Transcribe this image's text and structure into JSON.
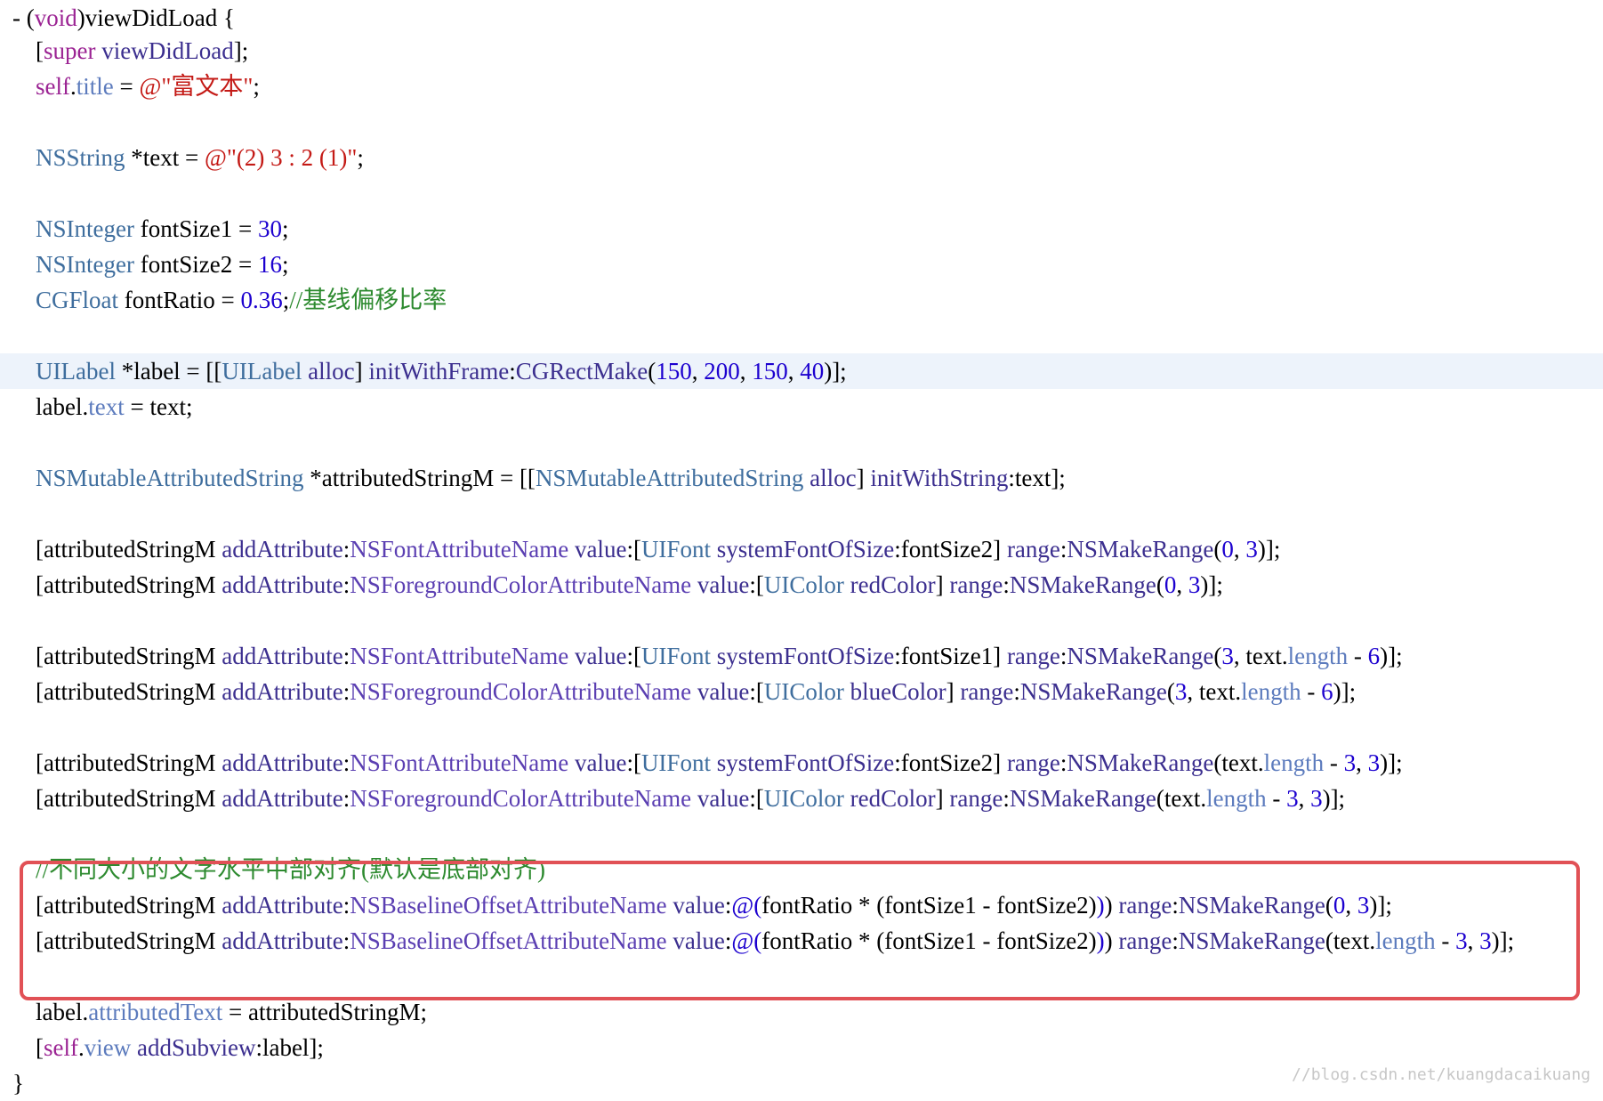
{
  "code": {
    "lines": [
      {
        "tokens": [
          [
            "plain",
            "- ("
          ],
          [
            "keyword",
            "void"
          ],
          [
            "plain",
            ")viewDidLoad {"
          ]
        ]
      },
      {
        "tokens": [
          [
            "plain",
            "["
          ],
          [
            "keyword",
            "super"
          ],
          [
            "plain",
            " "
          ],
          [
            "method",
            "viewDidLoad"
          ],
          [
            "plain",
            "];"
          ]
        ]
      },
      {
        "tokens": [
          [
            "keyword",
            "self"
          ],
          [
            "plain",
            "."
          ],
          [
            "prop",
            "title"
          ],
          [
            "plain",
            " = "
          ],
          [
            "string",
            "@\"富文本\""
          ],
          [
            "plain",
            ";"
          ]
        ]
      },
      {
        "tokens": []
      },
      {
        "tokens": [
          [
            "type",
            "NSString"
          ],
          [
            "plain",
            " *text = "
          ],
          [
            "string",
            "@\"(2) 3 : 2 (1)\""
          ],
          [
            "plain",
            ";"
          ]
        ]
      },
      {
        "tokens": []
      },
      {
        "tokens": [
          [
            "type",
            "NSInteger"
          ],
          [
            "plain",
            " fontSize1 = "
          ],
          [
            "number",
            "30"
          ],
          [
            "plain",
            ";"
          ]
        ]
      },
      {
        "tokens": [
          [
            "type",
            "NSInteger"
          ],
          [
            "plain",
            " fontSize2 = "
          ],
          [
            "number",
            "16"
          ],
          [
            "plain",
            ";"
          ]
        ]
      },
      {
        "tokens": [
          [
            "type",
            "CGFloat"
          ],
          [
            "plain",
            " fontRatio = "
          ],
          [
            "number",
            "0.36"
          ],
          [
            "plain",
            ";"
          ],
          [
            "comment",
            "//基线偏移比率"
          ]
        ]
      },
      {
        "tokens": []
      },
      {
        "tokens": [
          [
            "type",
            "UILabel"
          ],
          [
            "plain",
            " *label = [["
          ],
          [
            "type",
            "UILabel"
          ],
          [
            "plain",
            " "
          ],
          [
            "method",
            "alloc"
          ],
          [
            "plain",
            "] "
          ],
          [
            "method",
            "initWithFrame"
          ],
          [
            "plain",
            ":"
          ],
          [
            "method",
            "CGRectMake"
          ],
          [
            "plain",
            "("
          ],
          [
            "number",
            "150"
          ],
          [
            "plain",
            ", "
          ],
          [
            "number",
            "200"
          ],
          [
            "plain",
            ", "
          ],
          [
            "number",
            "150"
          ],
          [
            "plain",
            ", "
          ],
          [
            "number",
            "40"
          ],
          [
            "plain",
            ")];"
          ]
        ]
      },
      {
        "tokens": [
          [
            "plain",
            "label."
          ],
          [
            "prop",
            "text"
          ],
          [
            "plain",
            " = text;"
          ]
        ]
      },
      {
        "tokens": []
      },
      {
        "tokens": [
          [
            "type",
            "NSMutableAttributedString"
          ],
          [
            "plain",
            " *attributedStringM = [["
          ],
          [
            "type",
            "NSMutableAttributedString"
          ],
          [
            "plain",
            " "
          ],
          [
            "method",
            "alloc"
          ],
          [
            "plain",
            "] "
          ],
          [
            "method",
            "initWithString"
          ],
          [
            "plain",
            ":text];"
          ]
        ]
      },
      {
        "tokens": []
      },
      {
        "tokens": [
          [
            "plain",
            "[attributedStringM "
          ],
          [
            "method",
            "addAttribute"
          ],
          [
            "plain",
            ":"
          ],
          [
            "const",
            "NSFontAttributeName"
          ],
          [
            "plain",
            " "
          ],
          [
            "method",
            "value"
          ],
          [
            "plain",
            ":["
          ],
          [
            "type",
            "UIFont"
          ],
          [
            "plain",
            " "
          ],
          [
            "method",
            "systemFontOfSize"
          ],
          [
            "plain",
            ":fontSize2] "
          ],
          [
            "method",
            "range"
          ],
          [
            "plain",
            ":"
          ],
          [
            "method",
            "NSMakeRange"
          ],
          [
            "plain",
            "("
          ],
          [
            "number",
            "0"
          ],
          [
            "plain",
            ", "
          ],
          [
            "number",
            "3"
          ],
          [
            "plain",
            ")];"
          ]
        ]
      },
      {
        "tokens": [
          [
            "plain",
            "[attributedStringM "
          ],
          [
            "method",
            "addAttribute"
          ],
          [
            "plain",
            ":"
          ],
          [
            "const",
            "NSForegroundColorAttributeName"
          ],
          [
            "plain",
            " "
          ],
          [
            "method",
            "value"
          ],
          [
            "plain",
            ":["
          ],
          [
            "type",
            "UIColor"
          ],
          [
            "plain",
            " "
          ],
          [
            "method",
            "redColor"
          ],
          [
            "plain",
            "] "
          ],
          [
            "method",
            "range"
          ],
          [
            "plain",
            ":"
          ],
          [
            "method",
            "NSMakeRange"
          ],
          [
            "plain",
            "("
          ],
          [
            "number",
            "0"
          ],
          [
            "plain",
            ", "
          ],
          [
            "number",
            "3"
          ],
          [
            "plain",
            ")];"
          ]
        ]
      },
      {
        "tokens": []
      },
      {
        "tokens": [
          [
            "plain",
            "[attributedStringM "
          ],
          [
            "method",
            "addAttribute"
          ],
          [
            "plain",
            ":"
          ],
          [
            "const",
            "NSFontAttributeName"
          ],
          [
            "plain",
            " "
          ],
          [
            "method",
            "value"
          ],
          [
            "plain",
            ":["
          ],
          [
            "type",
            "UIFont"
          ],
          [
            "plain",
            " "
          ],
          [
            "method",
            "systemFontOfSize"
          ],
          [
            "plain",
            ":fontSize1] "
          ],
          [
            "method",
            "range"
          ],
          [
            "plain",
            ":"
          ],
          [
            "method",
            "NSMakeRange"
          ],
          [
            "plain",
            "("
          ],
          [
            "number",
            "3"
          ],
          [
            "plain",
            ", text."
          ],
          [
            "prop",
            "length"
          ],
          [
            "plain",
            " - "
          ],
          [
            "number",
            "6"
          ],
          [
            "plain",
            ")];"
          ]
        ]
      },
      {
        "tokens": [
          [
            "plain",
            "[attributedStringM "
          ],
          [
            "method",
            "addAttribute"
          ],
          [
            "plain",
            ":"
          ],
          [
            "const",
            "NSForegroundColorAttributeName"
          ],
          [
            "plain",
            " "
          ],
          [
            "method",
            "value"
          ],
          [
            "plain",
            ":["
          ],
          [
            "type",
            "UIColor"
          ],
          [
            "plain",
            " "
          ],
          [
            "method",
            "blueColor"
          ],
          [
            "plain",
            "] "
          ],
          [
            "method",
            "range"
          ],
          [
            "plain",
            ":"
          ],
          [
            "method",
            "NSMakeRange"
          ],
          [
            "plain",
            "("
          ],
          [
            "number",
            "3"
          ],
          [
            "plain",
            ", text."
          ],
          [
            "prop",
            "length"
          ],
          [
            "plain",
            " - "
          ],
          [
            "number",
            "6"
          ],
          [
            "plain",
            ")];"
          ]
        ]
      },
      {
        "tokens": []
      },
      {
        "tokens": [
          [
            "plain",
            "[attributedStringM "
          ],
          [
            "method",
            "addAttribute"
          ],
          [
            "plain",
            ":"
          ],
          [
            "const",
            "NSFontAttributeName"
          ],
          [
            "plain",
            " "
          ],
          [
            "method",
            "value"
          ],
          [
            "plain",
            ":["
          ],
          [
            "type",
            "UIFont"
          ],
          [
            "plain",
            " "
          ],
          [
            "method",
            "systemFontOfSize"
          ],
          [
            "plain",
            ":fontSize2] "
          ],
          [
            "method",
            "range"
          ],
          [
            "plain",
            ":"
          ],
          [
            "method",
            "NSMakeRange"
          ],
          [
            "plain",
            "(text."
          ],
          [
            "prop",
            "length"
          ],
          [
            "plain",
            " - "
          ],
          [
            "number",
            "3"
          ],
          [
            "plain",
            ", "
          ],
          [
            "number",
            "3"
          ],
          [
            "plain",
            ")];"
          ]
        ]
      },
      {
        "tokens": [
          [
            "plain",
            "[attributedStringM "
          ],
          [
            "method",
            "addAttribute"
          ],
          [
            "plain",
            ":"
          ],
          [
            "const",
            "NSForegroundColorAttributeName"
          ],
          [
            "plain",
            " "
          ],
          [
            "method",
            "value"
          ],
          [
            "plain",
            ":["
          ],
          [
            "type",
            "UIColor"
          ],
          [
            "plain",
            " "
          ],
          [
            "method",
            "redColor"
          ],
          [
            "plain",
            "] "
          ],
          [
            "method",
            "range"
          ],
          [
            "plain",
            ":"
          ],
          [
            "method",
            "NSMakeRange"
          ],
          [
            "plain",
            "(text."
          ],
          [
            "prop",
            "length"
          ],
          [
            "plain",
            " - "
          ],
          [
            "number",
            "3"
          ],
          [
            "plain",
            ", "
          ],
          [
            "number",
            "3"
          ],
          [
            "plain",
            ")];"
          ]
        ]
      },
      {
        "tokens": []
      },
      {
        "tokens": [
          [
            "comment",
            "//不同大小的文字水平中部对齐(默认是底部对齐)"
          ]
        ]
      },
      {
        "tokens": [
          [
            "plain",
            "[attributedStringM "
          ],
          [
            "method",
            "addAttribute"
          ],
          [
            "plain",
            ":"
          ],
          [
            "const",
            "NSBaselineOffsetAttributeName"
          ],
          [
            "plain",
            " "
          ],
          [
            "method",
            "value"
          ],
          [
            "plain",
            ":"
          ],
          [
            "number",
            "@("
          ],
          [
            "plain",
            "fontRatio * (fontSize1 - fontSize2)"
          ],
          [
            "number",
            ")"
          ],
          [
            "plain",
            ") "
          ],
          [
            "method",
            "range"
          ],
          [
            "plain",
            ":"
          ],
          [
            "method",
            "NSMakeRange"
          ],
          [
            "plain",
            "("
          ],
          [
            "number",
            "0"
          ],
          [
            "plain",
            ", "
          ],
          [
            "number",
            "3"
          ],
          [
            "plain",
            ")];"
          ]
        ]
      },
      {
        "tokens": [
          [
            "plain",
            "[attributedStringM "
          ],
          [
            "method",
            "addAttribute"
          ],
          [
            "plain",
            ":"
          ],
          [
            "const",
            "NSBaselineOffsetAttributeName"
          ],
          [
            "plain",
            " "
          ],
          [
            "method",
            "value"
          ],
          [
            "plain",
            ":"
          ],
          [
            "number",
            "@("
          ],
          [
            "plain",
            "fontRatio * (fontSize1 - fontSize2)"
          ],
          [
            "number",
            ")"
          ],
          [
            "plain",
            ") "
          ],
          [
            "method",
            "range"
          ],
          [
            "plain",
            ":"
          ],
          [
            "method",
            "NSMakeRange"
          ],
          [
            "plain",
            "(text."
          ],
          [
            "prop",
            "length"
          ],
          [
            "plain",
            " - "
          ],
          [
            "number",
            "3"
          ],
          [
            "plain",
            ", "
          ],
          [
            "number",
            "3"
          ],
          [
            "plain",
            ")];"
          ]
        ]
      },
      {
        "tokens": []
      },
      {
        "tokens": [
          [
            "plain",
            "label."
          ],
          [
            "prop",
            "attributedText"
          ],
          [
            "plain",
            " = attributedStringM;"
          ]
        ]
      },
      {
        "tokens": [
          [
            "plain",
            "["
          ],
          [
            "keyword",
            "self"
          ],
          [
            "plain",
            "."
          ],
          [
            "prop",
            "view"
          ],
          [
            "plain",
            " "
          ],
          [
            "method",
            "addSubview"
          ],
          [
            "plain",
            ":label];"
          ]
        ]
      },
      {
        "tokens": [
          [
            "plain",
            "}"
          ]
        ]
      }
    ]
  },
  "watermark": "//blog.csdn.net/kuangdacaikuang",
  "colors": {
    "highlight_line_background": "#edf3fb",
    "callout_border": "#e15156",
    "keyword": "#9b2393",
    "type": "#3f6e9e",
    "method": "#3c2f8f",
    "constant": "#5b3fb2",
    "string": "#c41a16",
    "number": "#1c00cf",
    "comment": "#2d8a2f",
    "property": "#5c7bbd"
  }
}
